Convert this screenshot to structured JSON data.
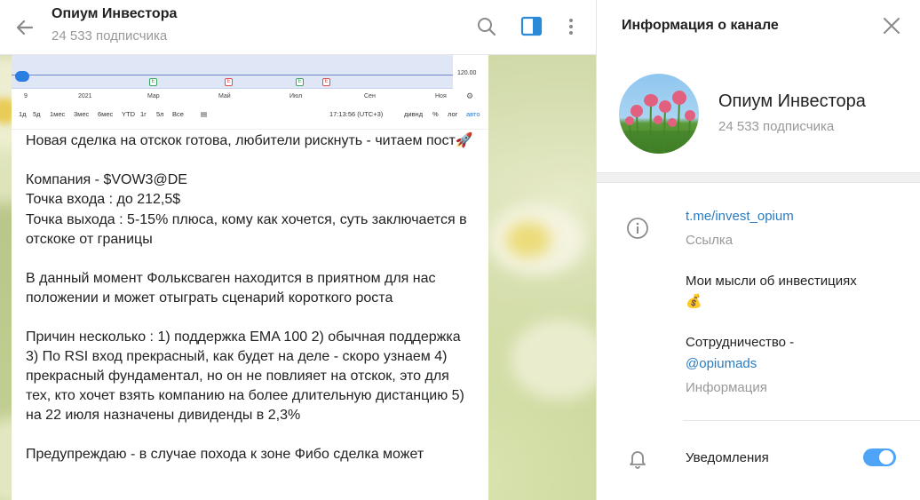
{
  "chat": {
    "title": "Опиум Инвестора",
    "subscribers": "24 533 подписчика",
    "icons": {
      "back": "back-arrow-icon",
      "search": "search-icon",
      "panel": "sidebar-panel-icon",
      "more": "more-vertical-icon"
    }
  },
  "chart_preview": {
    "price_label": "120.00",
    "earnings_markers": [
      "E",
      "E",
      "E",
      "E"
    ],
    "axis_labels": [
      "9",
      "2021",
      "Мар",
      "Май",
      "Июл",
      "Сен",
      "Ноя"
    ],
    "toolbar": [
      "1д",
      "5д",
      "1мес",
      "3мес",
      "6мес",
      "YTD",
      "1г",
      "5л",
      "Все"
    ],
    "time": "17:13:56 (UTC+3)",
    "toolbar_right": [
      "дивнд",
      "%",
      "лог",
      "авто"
    ]
  },
  "message": {
    "paragraphs": [
      "Новая сделка на отскок готова, любители рискнуть - читаем пост🚀",
      "Компания - $VOW3@DE",
      "Точка входа : до 212,5$",
      "Точка выхода : 5-15% плюса, кому как хочется, суть заключается в отскоке от границы",
      "В данный момент Фольксваген находится в приятном для нас положении и может отыграть сценарий короткого роста",
      "Причин несколько : 1) поддержка EMA 100 2) обычная поддержка 3) По RSI вход прекрасный, как будет на деле - скоро узнаем 4) прекрасный фундаментал, но он не повлияет на отскок, это для тех, кто хочет взять компанию на более длительную дистанцию 5) на 22 июля назначены дивиденды в 2,3%",
      "Предупреждаю - в случае похода к зоне Фибо сделка может"
    ]
  },
  "info_panel": {
    "title": "Информация о канале",
    "close_icon": "close-icon",
    "name": "Опиум Инвестора",
    "subscribers": "24 533 подписчика",
    "link": "t.me/invest_opium",
    "link_label": "Ссылка",
    "description": "Мои мысли об инвестициях",
    "description_emoji": "💰",
    "cooperation": "Сотрудничество -",
    "cooperation_link": "@opiumads",
    "cooperation_label": "Информация",
    "notifications_label": "Уведомления",
    "notifications_on": true
  }
}
